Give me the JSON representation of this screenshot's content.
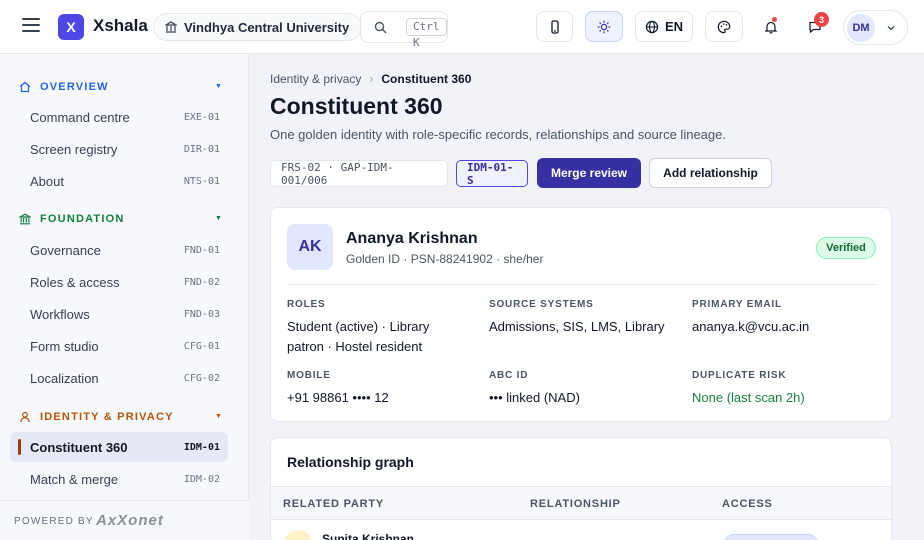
{
  "header": {
    "brand_initial": "X",
    "brand": "Xshala",
    "university": "Vindhya Central University",
    "search_shortcut": "Ctrl K",
    "language": "EN",
    "chat_count": "3",
    "user_initials": "DM"
  },
  "sidebar": {
    "sections": [
      {
        "label": "OVERVIEW",
        "color": "#2563eb",
        "icon": "home-icon"
      },
      {
        "label": "FOUNDATION",
        "color": "#15803d",
        "icon": "bank-icon"
      },
      {
        "label": "IDENTITY & PRIVACY",
        "color": "#b45309",
        "icon": "person-icon"
      }
    ],
    "items": [
      {
        "label": "Command centre",
        "code": "EXE-01"
      },
      {
        "label": "Screen registry",
        "code": "DIR-01"
      },
      {
        "label": "About",
        "code": "NTS-01"
      },
      {
        "label": "Governance",
        "code": "FND-01"
      },
      {
        "label": "Roles & access",
        "code": "FND-02"
      },
      {
        "label": "Workflows",
        "code": "FND-03"
      },
      {
        "label": "Form studio",
        "code": "CFG-01"
      },
      {
        "label": "Localization",
        "code": "CFG-02"
      },
      {
        "label": "Constituent 360",
        "code": "IDM-01",
        "active": true
      },
      {
        "label": "Match & merge",
        "code": "IDM-02"
      }
    ],
    "powered_by": "POWERED BY",
    "powered_logo": "AxXonet"
  },
  "main": {
    "breadcrumb": {
      "parent": "Identity & privacy",
      "separator": "›",
      "current": "Constituent 360"
    },
    "title": "Constituent 360",
    "subtitle": "One golden identity with role-specific records, relationships and source lineage.",
    "ref_chip": "FRS-02 · GAP-IDM-001/006",
    "id_chip": "IDM-01-S",
    "merge_button": "Merge review",
    "add_button": "Add relationship"
  },
  "profile": {
    "initials": "AK",
    "name": "Ananya Krishnan",
    "meta": "Golden ID · PSN-88241902 · she/her",
    "status": "Verified",
    "fields": {
      "roles_label": "ROLES",
      "roles_line1": "Student (active) · Library",
      "roles_line2": "patron · Hostel resident",
      "sources_label": "SOURCE SYSTEMS",
      "sources_value": "Admissions, SIS, LMS, Library",
      "email_label": "PRIMARY EMAIL",
      "email_value": "ananya.k@vcu.ac.in",
      "mobile_label": "MOBILE",
      "mobile_value": "+91 98861 •••• 12",
      "abc_label": "ABC ID",
      "abc_value": "••• linked (NAD)",
      "dup_label": "DUPLICATE RISK",
      "dup_value": "None (last scan 2h)"
    }
  },
  "graph": {
    "title": "Relationship graph",
    "columns": [
      "RELATED PARTY",
      "RELATIONSHIP",
      "ACCESS"
    ],
    "rows": [
      {
        "name": "Sunita Krishnan"
      }
    ]
  }
}
